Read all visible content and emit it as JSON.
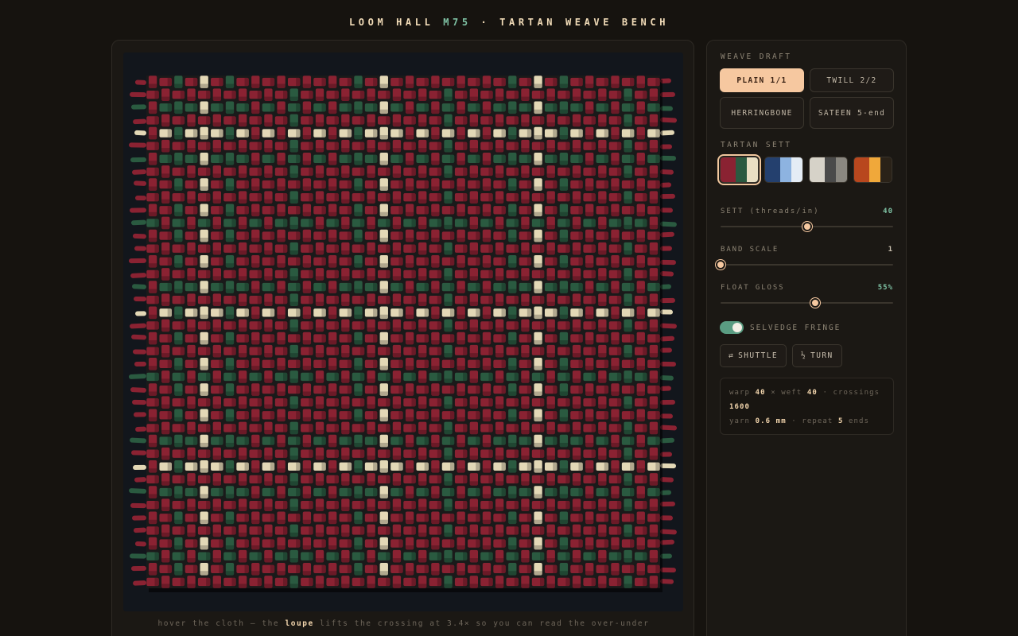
{
  "header": {
    "title_prefix": "LOOM HALL",
    "title_accent": "M75",
    "title_suffix": "· TARTAN WEAVE BENCH"
  },
  "stage": {
    "hint_before": "hover the cloth — the",
    "hint_emph": "loupe",
    "hint_after": "lifts the crossing at 3.4× so you can read the over-under"
  },
  "panel": {
    "weave_draft_label": "WEAVE DRAFT",
    "drafts": [
      {
        "label": "PLAIN 1/1",
        "active": true
      },
      {
        "label": "TWILL 2/2",
        "active": false
      },
      {
        "label": "HERRINGBONE",
        "active": false
      },
      {
        "label": "SATEEN 5-end",
        "active": false
      }
    ],
    "tartan_sett_label": "TARTAN SETT",
    "setts": [
      {
        "name": "crimson-forest",
        "colors": [
          "#8a2232",
          "#2a5a40",
          "#e9dfc3"
        ],
        "active": true
      },
      {
        "name": "navy-sky",
        "colors": [
          "#24406e",
          "#8db3e0",
          "#e4ecf5"
        ],
        "active": false
      },
      {
        "name": "stone-slate",
        "colors": [
          "#d6d2c8",
          "#4a4a4a",
          "#8a8780"
        ],
        "active": false
      },
      {
        "name": "rust-amber",
        "colors": [
          "#b8471e",
          "#f0a83a",
          "#2a2218"
        ],
        "active": false
      }
    ],
    "sliders": [
      {
        "label": "SETT (threads/in)",
        "value": "40",
        "fraction": 0.5
      },
      {
        "label": "BAND SCALE",
        "value": "1",
        "fraction": 0.0
      },
      {
        "label": "FLOAT GLOSS",
        "value": "55%",
        "fraction": 0.55
      }
    ],
    "toggle": {
      "label": "SELVEDGE FRINGE",
      "on": true
    },
    "actions": {
      "shuttle_icon": "⇄",
      "shuttle_label": "SHUTTLE",
      "turn_icon": "½",
      "turn_label": "TURN"
    },
    "stats": {
      "warp_label": "warp",
      "warp_value": "40",
      "times": "×",
      "weft_label": "weft",
      "weft_value": "40",
      "crossings_label": "· crossings",
      "crossings_value": "1600",
      "yarn_label": "yarn",
      "yarn_value": "0.6 mm",
      "repeat_label": "· repeat",
      "repeat_value": "5",
      "repeat_unit": "ends"
    }
  },
  "cloth": {
    "warp_count": 40,
    "weft_count": 40,
    "palette": {
      "red": "#8a2232",
      "green": "#2a5a40",
      "cream": "#e3d8b6",
      "bg": "#12161c"
    },
    "thread_sequence": "RRGRCRGRRRRGRRRRGRCRRRRGRRRRGRCRGRRRRGRR"
  }
}
